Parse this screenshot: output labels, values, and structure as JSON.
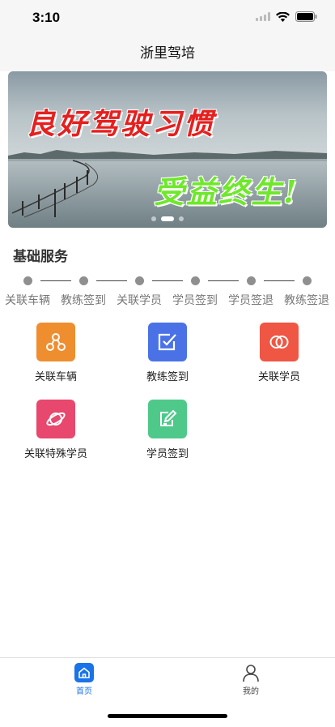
{
  "status_bar": {
    "time": "3:10"
  },
  "nav": {
    "title": "浙里驾培"
  },
  "banner": {
    "text_top": "良好驾驶习惯",
    "text_bottom": "受益终生!",
    "page_count": 3,
    "active_page": 1
  },
  "services": {
    "title": "基础服务",
    "steps": [
      "关联车辆",
      "教练签到",
      "关联学员",
      "学员签到",
      "学员签退",
      "教练签退"
    ],
    "items": [
      {
        "label": "关联车辆",
        "icon": "link-nodes-icon",
        "color": "#ef8e2f"
      },
      {
        "label": "教练签到",
        "icon": "checkbox-icon",
        "color": "#4a72e6"
      },
      {
        "label": "关联学员",
        "icon": "rings-icon",
        "color": "#ef5644"
      },
      {
        "label": "关联特殊学员",
        "icon": "planet-icon",
        "color": "#e8476e"
      },
      {
        "label": "学员签到",
        "icon": "edit-note-icon",
        "color": "#4fc98a"
      }
    ]
  },
  "tab_bar": {
    "tabs": [
      {
        "label": "首页",
        "icon": "home-icon",
        "active": true
      },
      {
        "label": "我的",
        "icon": "person-icon",
        "active": false
      }
    ],
    "active_color": "#1a73e8",
    "inactive_color": "#444444"
  }
}
